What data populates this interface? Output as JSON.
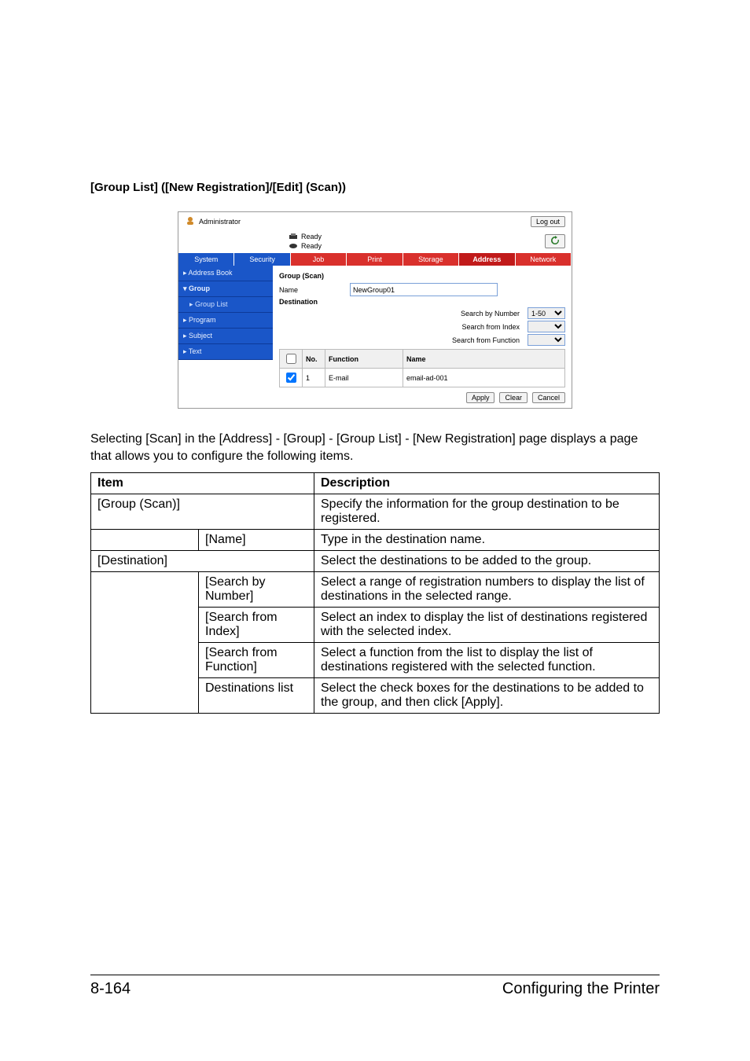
{
  "heading": "[Group List] ([New Registration]/[Edit] (Scan))",
  "app": {
    "admin_label": "Administrator",
    "logout_label": "Log out",
    "status1": "Ready",
    "status2": "Ready",
    "tabs": {
      "system": "System",
      "security": "Security",
      "job": "Job",
      "print": "Print",
      "storage": "Storage",
      "address": "Address",
      "network": "Network"
    },
    "sidebar": {
      "address_book": "▸ Address Book",
      "group": "▾ Group",
      "group_list": "▸ Group List",
      "program": "▸ Program",
      "subject": "▸ Subject",
      "text": "▸ Text"
    },
    "section_title": "Group (Scan)",
    "name_label": "Name",
    "name_value": "NewGroup01",
    "destination_label": "Destination",
    "search_number_label": "Search by Number",
    "search_number_value": "1-50",
    "search_index_label": "Search from Index",
    "search_function_label": "Search from Function",
    "th_no": "No.",
    "th_function": "Function",
    "th_name": "Name",
    "row_no": "1",
    "row_function": "E-mail",
    "row_name": "email-ad-001",
    "apply": "Apply",
    "clear": "Clear",
    "cancel": "Cancel"
  },
  "paragraph": "Selecting [Scan] in the [Address] - [Group] - [Group List] - [New Registration] page displays a page that allows you to configure the following items.",
  "table": {
    "h_item": "Item",
    "h_desc": "Description",
    "rows": [
      {
        "a": "[Group (Scan)]",
        "b": "",
        "c": "Specify the information for the group destination to be registered."
      },
      {
        "a": "",
        "b": "[Name]",
        "c": "Type in the destination name."
      },
      {
        "a": "[Destination]",
        "b": "",
        "c": "Select the destinations to be added to the group."
      },
      {
        "a": "",
        "b": "[Search by Number]",
        "c": "Select a range of registration numbers to display the list of destinations in the selected range."
      },
      {
        "a": "",
        "b": "[Search from Index]",
        "c": "Select an index to display the list of destinations registered with the selected index."
      },
      {
        "a": "",
        "b": "[Search from Function]",
        "c": "Select a function from the list to display the list of destinations registered with the selected function."
      },
      {
        "a": "",
        "b": "Destinations list",
        "c": "Select the check boxes for the destinations to be added to the group, and then click [Apply]."
      }
    ]
  },
  "footer": {
    "page": "8-164",
    "title": "Configuring the Printer"
  }
}
